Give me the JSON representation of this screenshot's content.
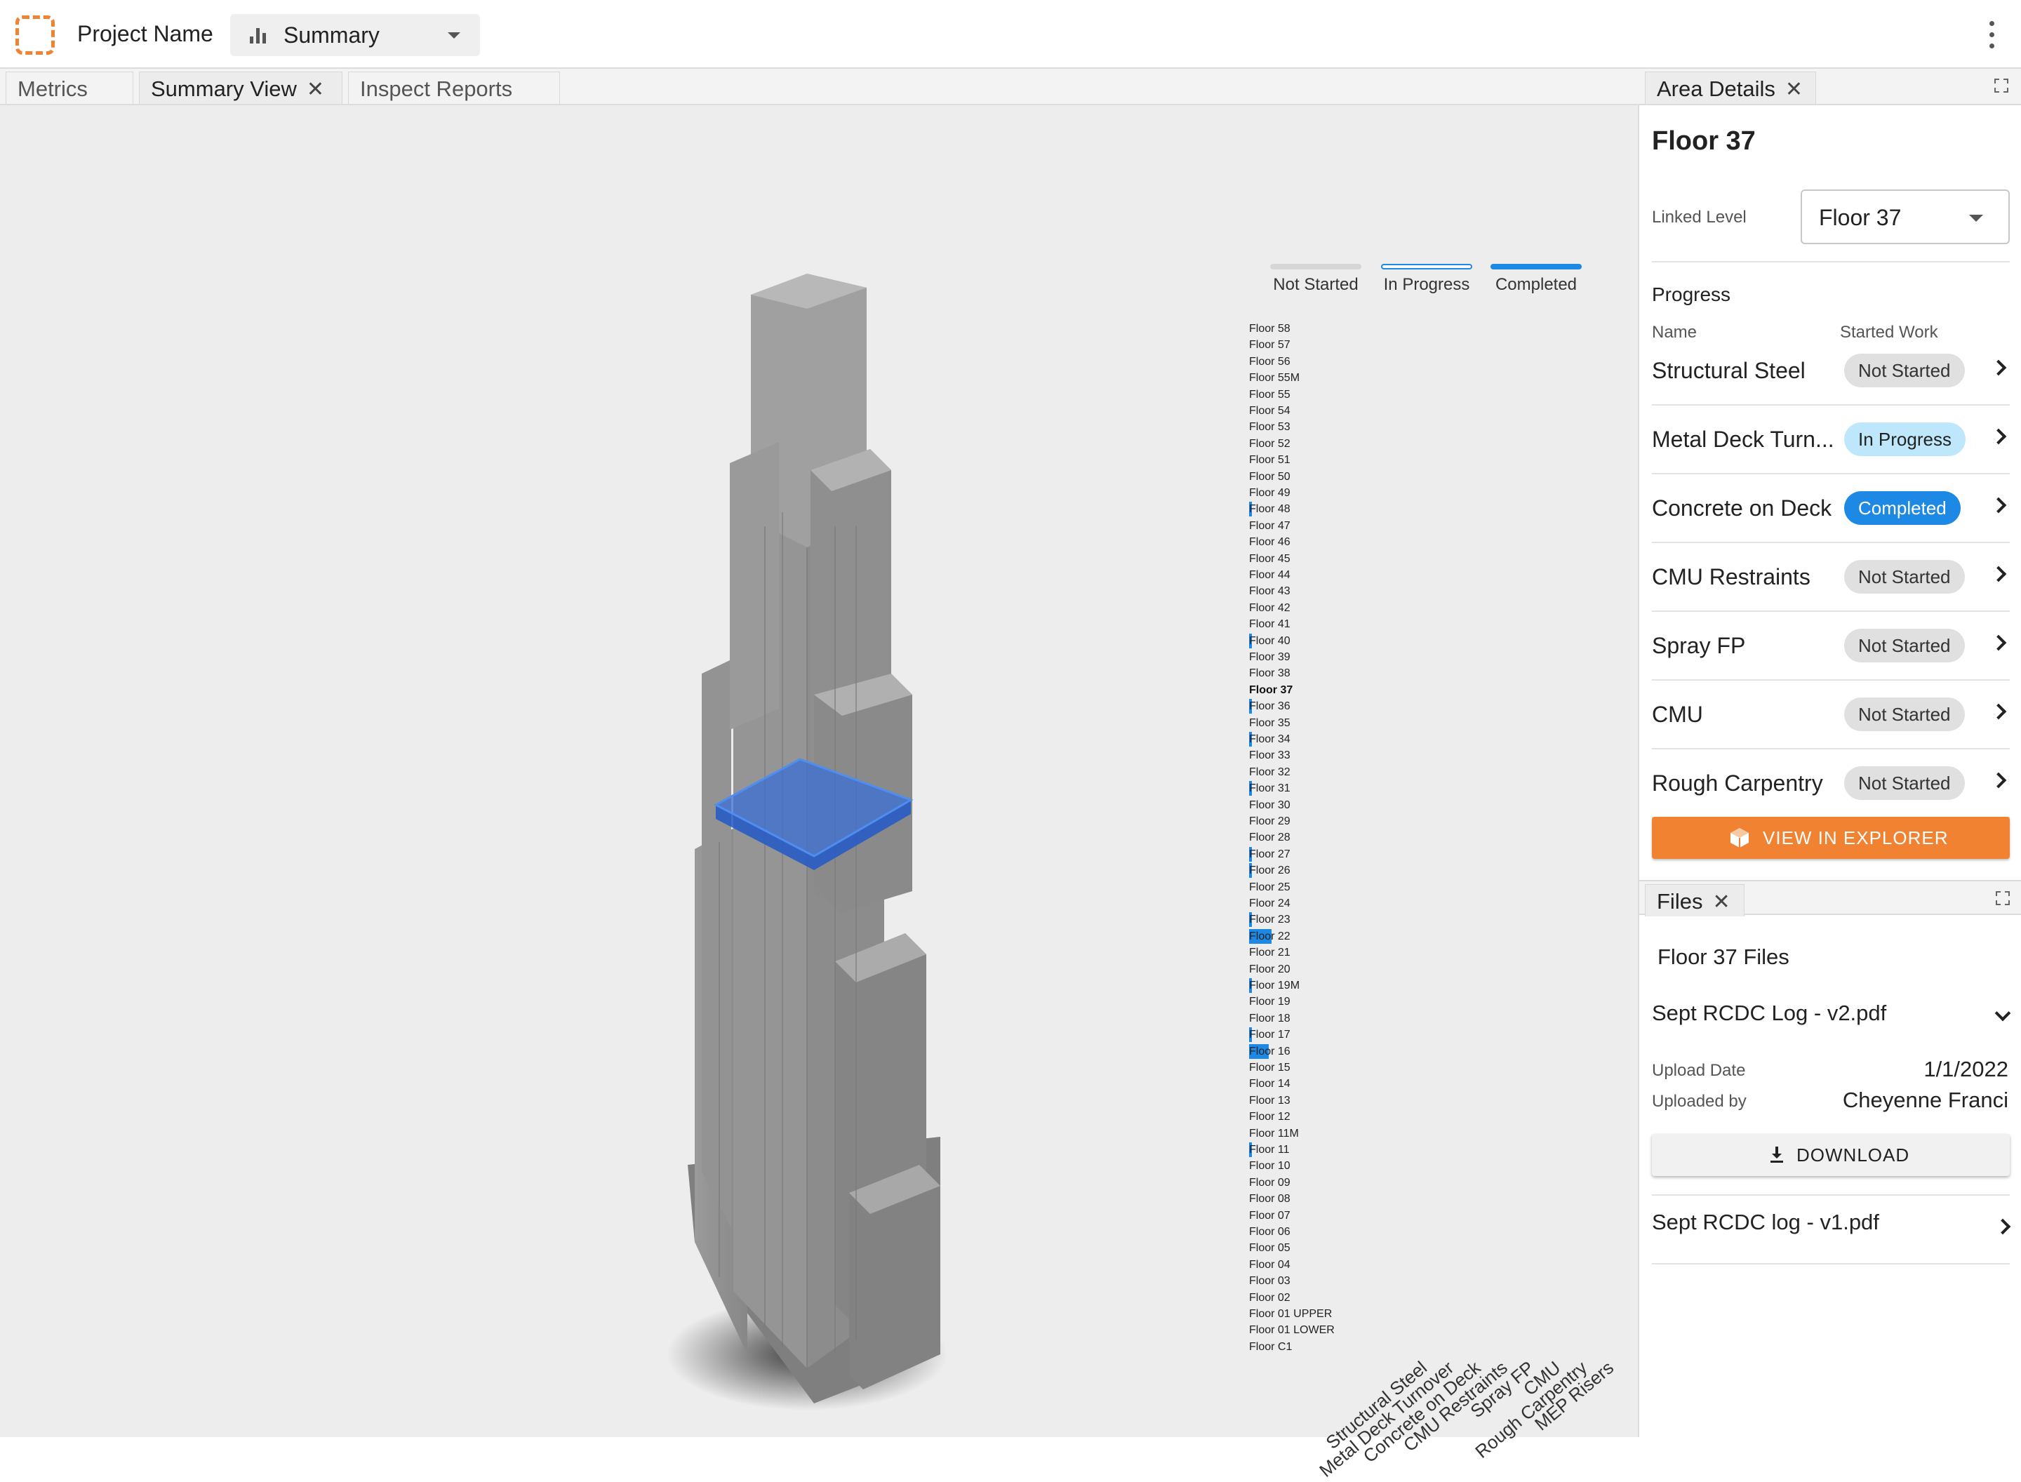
{
  "header": {
    "project_name": "Project Name",
    "view_select": "Summary",
    "icons": {
      "logo": "dashed-square-logo-icon",
      "view": "bar-chart-icon",
      "menu": "kebab-menu-icon"
    }
  },
  "tabs": [
    {
      "label": "Metrics",
      "active": false,
      "closable": false
    },
    {
      "label": "Summary View",
      "active": true,
      "closable": true
    },
    {
      "label": "Inspect Reports",
      "active": false,
      "closable": false
    }
  ],
  "legend": [
    {
      "label": "Not Started",
      "color": "#d6d6d6"
    },
    {
      "label": "In Progress",
      "color": "#1e88e5"
    },
    {
      "label": "Completed",
      "color": "#1e88e5"
    }
  ],
  "matrix": {
    "trades": [
      "Structural Steel",
      "Metal Deck Turnover",
      "Concrete on Deck",
      "CMU Restraints",
      "Spray FP",
      "CMU",
      "Rough Carpentry",
      "MEP Risers"
    ],
    "selected_floor": "Floor 37",
    "status_codes": {
      "0": "Not Started",
      "1": "In Progress",
      "2": "Completed",
      "3": "Selected"
    },
    "floors": [
      {
        "name": "Floor 58",
        "s": [
          0,
          0,
          0,
          0,
          0,
          0,
          0,
          0
        ]
      },
      {
        "name": "Floor 57",
        "s": [
          0,
          0,
          0,
          0,
          0,
          0,
          0,
          0
        ]
      },
      {
        "name": "Floor 56",
        "s": [
          0,
          0,
          0,
          0,
          0,
          0,
          0,
          0
        ]
      },
      {
        "name": "Floor 55M",
        "s": [
          0,
          0,
          0,
          0,
          0,
          0,
          0,
          0
        ]
      },
      {
        "name": "Floor 55",
        "s": [
          0,
          0,
          0,
          0,
          0,
          0,
          0,
          0
        ]
      },
      {
        "name": "Floor 54",
        "s": [
          0,
          0,
          0,
          0,
          0,
          0,
          0,
          0
        ]
      },
      {
        "name": "Floor 53",
        "s": [
          0,
          0,
          0,
          0,
          0,
          0,
          0,
          0
        ]
      },
      {
        "name": "Floor 52",
        "s": [
          0,
          0,
          0,
          0,
          0,
          0,
          0,
          0
        ]
      },
      {
        "name": "Floor 51",
        "s": [
          0,
          0,
          0,
          0,
          0,
          0,
          0,
          0
        ]
      },
      {
        "name": "Floor 50",
        "s": [
          0,
          0,
          0,
          0,
          0,
          0,
          0,
          0
        ]
      },
      {
        "name": "Floor 49",
        "s": [
          0,
          0,
          0,
          0,
          0,
          0,
          0,
          0
        ]
      },
      {
        "name": "Floor 48",
        "s": [
          1,
          0,
          0,
          0,
          0,
          0,
          0,
          0
        ]
      },
      {
        "name": "Floor 47",
        "s": [
          0,
          0,
          0,
          0,
          0,
          0,
          0,
          0
        ]
      },
      {
        "name": "Floor 46",
        "s": [
          0,
          0,
          0,
          0,
          0,
          0,
          0,
          0
        ]
      },
      {
        "name": "Floor 45",
        "s": [
          0,
          0,
          0,
          0,
          0,
          0,
          0,
          0
        ]
      },
      {
        "name": "Floor 44",
        "s": [
          0,
          0,
          0,
          0,
          0,
          0,
          0,
          0
        ]
      },
      {
        "name": "Floor 43",
        "s": [
          0,
          0,
          0,
          0,
          0,
          0,
          0,
          0
        ]
      },
      {
        "name": "Floor 42",
        "s": [
          0,
          0,
          0,
          0,
          0,
          0,
          0,
          0
        ]
      },
      {
        "name": "Floor 41",
        "s": [
          0,
          0,
          0,
          0,
          0,
          0,
          0,
          0
        ]
      },
      {
        "name": "Floor 40",
        "s": [
          1,
          2,
          2,
          0,
          0,
          0,
          0,
          0
        ]
      },
      {
        "name": "Floor 39",
        "s": [
          0,
          0,
          0,
          0,
          0,
          0,
          0,
          0
        ]
      },
      {
        "name": "Floor 38",
        "s": [
          0,
          0,
          0,
          0,
          0,
          0,
          0,
          0
        ]
      },
      {
        "name": "Floor 37",
        "s": [
          3,
          3,
          4,
          3,
          3,
          3,
          3,
          3
        ]
      },
      {
        "name": "Floor 36",
        "s": [
          1,
          2,
          0,
          0,
          0,
          0,
          0,
          0
        ]
      },
      {
        "name": "Floor 35",
        "s": [
          0,
          0,
          0,
          0,
          0,
          0,
          0,
          0
        ]
      },
      {
        "name": "Floor 34",
        "s": [
          1,
          0,
          0,
          0,
          0,
          0,
          0,
          0
        ]
      },
      {
        "name": "Floor 33",
        "s": [
          0,
          0,
          0,
          0,
          0,
          0,
          0,
          0
        ]
      },
      {
        "name": "Floor 32",
        "s": [
          0,
          0,
          0,
          0,
          0,
          0,
          0,
          0
        ]
      },
      {
        "name": "Floor 31",
        "s": [
          0,
          0,
          0,
          0,
          0,
          0,
          0,
          1
        ]
      },
      {
        "name": "Floor 30",
        "s": [
          0,
          0,
          0,
          0,
          0,
          0,
          0,
          0
        ]
      },
      {
        "name": "Floor 29",
        "s": [
          0,
          0,
          0,
          0,
          0,
          0,
          0,
          0
        ]
      },
      {
        "name": "Floor 28",
        "s": [
          0,
          0,
          0,
          0,
          0,
          0,
          0,
          0
        ]
      },
      {
        "name": "Floor 27",
        "s": [
          1,
          0,
          0,
          0,
          0,
          0,
          0,
          0
        ]
      },
      {
        "name": "Floor 26",
        "s": [
          0,
          0,
          0,
          1,
          0,
          0,
          0,
          0
        ]
      },
      {
        "name": "Floor 25",
        "s": [
          0,
          0,
          0,
          0,
          0,
          0,
          0,
          0
        ]
      },
      {
        "name": "Floor 24",
        "s": [
          0,
          0,
          0,
          0,
          0,
          0,
          0,
          0
        ]
      },
      {
        "name": "Floor 23",
        "s": [
          1,
          0,
          0,
          0,
          0,
          0,
          0,
          0
        ]
      },
      {
        "name": "Floor 22",
        "s": [
          1,
          1,
          1,
          1,
          1,
          1,
          1,
          1
        ]
      },
      {
        "name": "Floor 21",
        "s": [
          0,
          0,
          0,
          0,
          0,
          0,
          0,
          0
        ]
      },
      {
        "name": "Floor 20",
        "s": [
          0,
          0,
          0,
          0,
          0,
          0,
          0,
          0
        ]
      },
      {
        "name": "Floor 19M",
        "s": [
          1,
          0,
          0,
          2,
          0,
          0,
          0,
          0
        ]
      },
      {
        "name": "Floor 19",
        "s": [
          0,
          0,
          0,
          0,
          0,
          0,
          0,
          0
        ]
      },
      {
        "name": "Floor 18",
        "s": [
          0,
          0,
          0,
          0,
          0,
          0,
          0,
          0
        ]
      },
      {
        "name": "Floor 17",
        "s": [
          0,
          0,
          1,
          0,
          0,
          0,
          0,
          0
        ]
      },
      {
        "name": "Floor 16",
        "s": [
          1,
          1,
          1,
          1,
          1,
          2,
          1,
          1
        ]
      },
      {
        "name": "Floor 15",
        "s": [
          0,
          0,
          0,
          0,
          0,
          0,
          0,
          0
        ]
      },
      {
        "name": "Floor 14",
        "s": [
          0,
          0,
          0,
          0,
          0,
          0,
          0,
          0
        ]
      },
      {
        "name": "Floor 13",
        "s": [
          0,
          0,
          0,
          0,
          0,
          0,
          0,
          0
        ]
      },
      {
        "name": "Floor 12",
        "s": [
          0,
          0,
          0,
          0,
          0,
          0,
          0,
          0
        ]
      },
      {
        "name": "Floor 11M",
        "s": [
          2,
          0,
          0,
          0,
          0,
          0,
          0,
          0
        ]
      },
      {
        "name": "Floor 11",
        "s": [
          0,
          0,
          0,
          0,
          0,
          0,
          1,
          0
        ]
      },
      {
        "name": "Floor 10",
        "s": [
          0,
          0,
          0,
          0,
          0,
          0,
          0,
          0
        ]
      },
      {
        "name": "Floor 09",
        "s": [
          0,
          0,
          0,
          0,
          0,
          0,
          0,
          0
        ]
      },
      {
        "name": "Floor 08",
        "s": [
          0,
          0,
          0,
          0,
          0,
          0,
          0,
          0
        ]
      },
      {
        "name": "Floor 07",
        "s": [
          0,
          0,
          0,
          0,
          0,
          0,
          0,
          0
        ]
      },
      {
        "name": "Floor 06",
        "s": [
          0,
          0,
          0,
          0,
          0,
          0,
          0,
          0
        ]
      },
      {
        "name": "Floor 05",
        "s": [
          0,
          0,
          0,
          0,
          0,
          0,
          0,
          0
        ]
      },
      {
        "name": "Floor 04",
        "s": [
          0,
          0,
          0,
          0,
          0,
          0,
          0,
          0
        ]
      },
      {
        "name": "Floor 03",
        "s": [
          0,
          0,
          0,
          0,
          0,
          0,
          0,
          0
        ]
      },
      {
        "name": "Floor 02",
        "s": [
          0,
          0,
          0,
          0,
          0,
          0,
          0,
          0
        ]
      },
      {
        "name": "Floor 01 UPPER",
        "s": [
          0,
          0,
          0,
          0,
          0,
          0,
          0,
          0
        ]
      },
      {
        "name": "Floor 01 LOWER",
        "s": [
          0,
          0,
          0,
          0,
          0,
          0,
          0,
          0
        ]
      },
      {
        "name": "Floor C1",
        "s": [
          0,
          0,
          0,
          0,
          0,
          0,
          0,
          0
        ]
      }
    ]
  },
  "area_details": {
    "tab_label": "Area Details",
    "title": "Floor 37",
    "linked_level_label": "Linked Level",
    "linked_level_value": "Floor 37",
    "progress_label": "Progress",
    "col_name": "Name",
    "col_started": "Started Work",
    "rows": [
      {
        "name": "Structural Steel",
        "status": "Not Started",
        "kind": "ns"
      },
      {
        "name": "Metal Deck Turn...",
        "status": "In Progress",
        "kind": "ip"
      },
      {
        "name": "Concrete on Deck",
        "status": "Completed",
        "kind": "cp"
      },
      {
        "name": "CMU Restraints",
        "status": "Not Started",
        "kind": "ns"
      },
      {
        "name": "Spray FP",
        "status": "Not Started",
        "kind": "ns"
      },
      {
        "name": "CMU",
        "status": "Not Started",
        "kind": "ns"
      },
      {
        "name": "Rough Carpentry",
        "status": "Not Started",
        "kind": "ns"
      }
    ],
    "explorer_button": "VIEW IN EXPLORER"
  },
  "files": {
    "tab_label": "Files",
    "title": "Floor 37 Files",
    "items": [
      {
        "name": "Sept RCDC Log - v2.pdf",
        "expanded": true,
        "upload_date_label": "Upload Date",
        "upload_date": "1/1/2022",
        "uploaded_by_label": "Uploaded by",
        "uploaded_by": "Cheyenne Franci",
        "download_label": "DOWNLOAD"
      },
      {
        "name": "Sept RCDC log - v1.pdf",
        "expanded": false
      }
    ]
  }
}
